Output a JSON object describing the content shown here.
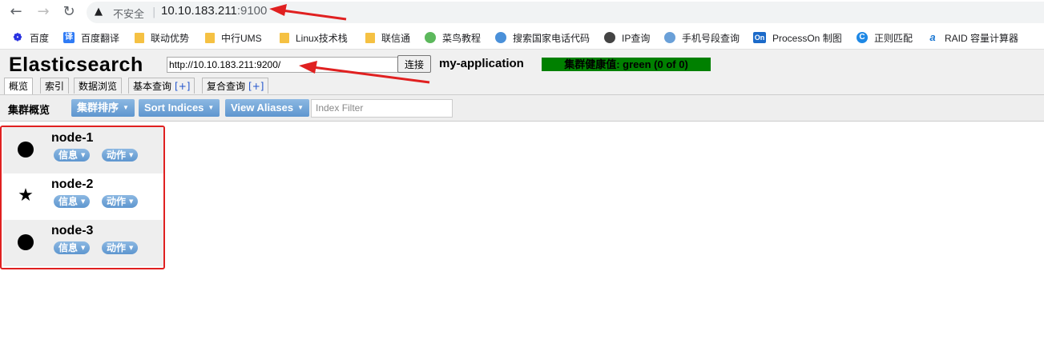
{
  "browser": {
    "back": "←",
    "forward": "→",
    "reload": "↻",
    "security_label": "不安全",
    "url_host": "10.10.183.211",
    "url_port": ":9100"
  },
  "bookmarks": [
    {
      "label": "百度",
      "icon": "paw-icon",
      "color": "#2932e1"
    },
    {
      "label": "百度翻译",
      "icon": "translate-icon",
      "color": "#2f7bf5"
    },
    {
      "label": "联动优势",
      "icon": "folder-icon"
    },
    {
      "label": "中行UMS",
      "icon": "folder-icon"
    },
    {
      "label": "Linux技术栈",
      "icon": "folder-icon"
    },
    {
      "label": "联信通",
      "icon": "folder-icon"
    },
    {
      "label": "菜鸟教程",
      "icon": "runoob-icon",
      "color": "#5cb85c"
    },
    {
      "label": "搜索国家电话代码",
      "icon": "globe-icon",
      "color": "#4a90d9"
    },
    {
      "label": "IP查询",
      "icon": "globe-icon",
      "color": "#444444"
    },
    {
      "label": "手机号段查询",
      "icon": "phone-icon",
      "color": "#6aa0d8"
    },
    {
      "label": "ProcessOn 制图",
      "icon": "processon-icon",
      "color": "#1b6ac9"
    },
    {
      "label": "正则匹配",
      "icon": "regex-icon",
      "color": "#1e88e5"
    },
    {
      "label": "RAID 容量计算器",
      "icon": "raid-icon",
      "color": "#1976d2"
    }
  ],
  "app": {
    "title": "Elasticsearch",
    "cluster_url": "http://10.10.183.211:9200/",
    "connect_label": "连接",
    "cluster_name": "my-application",
    "health": "集群健康值: green (0 of 0)",
    "health_color": "#008000"
  },
  "tabs": [
    {
      "label": "概览",
      "plus": ""
    },
    {
      "label": "索引",
      "plus": ""
    },
    {
      "label": "数据浏览",
      "plus": ""
    },
    {
      "label": "基本查询",
      "plus": "[+]"
    },
    {
      "label": "复合查询",
      "plus": "[+]"
    }
  ],
  "toolbar": {
    "label": "集群概览",
    "sort_cluster": "集群排序",
    "sort_indices": "Sort Indices",
    "view_aliases": "View Aliases",
    "filter_placeholder": "Index Filter"
  },
  "nodes": [
    {
      "name": "node-1",
      "icon": "circle-icon",
      "info": "信息",
      "actions": "动作"
    },
    {
      "name": "node-2",
      "icon": "star-icon",
      "info": "信息",
      "actions": "动作"
    },
    {
      "name": "node-3",
      "icon": "circle-icon",
      "info": "信息",
      "actions": "动作"
    }
  ],
  "annotation_color": "#e02020"
}
